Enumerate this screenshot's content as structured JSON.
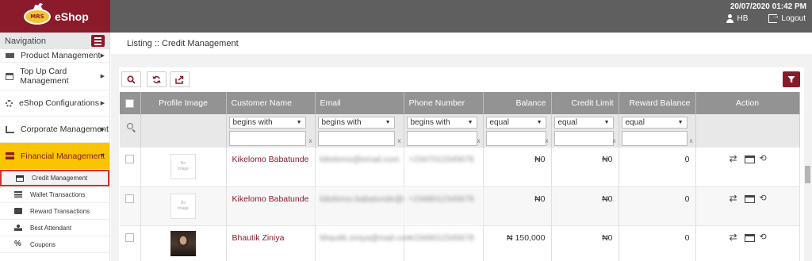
{
  "header": {
    "brand": "eShop",
    "logo_text": "MRS",
    "datetime": "20/07/2020 01:42 PM",
    "user": "HB",
    "logout": "Logout"
  },
  "sidebar": {
    "title": "Navigation",
    "items": [
      {
        "label": "Product Management",
        "icon": "box-icon"
      },
      {
        "label": "Top Up Card Management",
        "icon": "card-icon"
      },
      {
        "label": "eShop Configurations",
        "icon": "gear-icon"
      },
      {
        "label": "Corporate Management",
        "icon": "chart-icon"
      },
      {
        "label": "Financial Management",
        "icon": "finance-icon"
      }
    ],
    "sub_items": [
      {
        "label": "Credit Management",
        "icon": "card-icon"
      },
      {
        "label": "Wallet Transactions",
        "icon": "list-icon"
      },
      {
        "label": "Reward Transactions",
        "icon": "reward-icon"
      },
      {
        "label": "Best Attendant",
        "icon": "person-icon"
      },
      {
        "label": "Coupons",
        "icon": "percent-icon"
      }
    ]
  },
  "breadcrumb": "Listing :: Credit Management",
  "toolbar": {
    "filter_color": "#8b1a2b"
  },
  "table": {
    "columns": [
      "Profile Image",
      "Customer Name",
      "Email",
      "Phone Number",
      "Balance",
      "Credit Limit",
      "Reward Balance",
      "Action"
    ],
    "filters": {
      "name": "begins with",
      "email": "begins with",
      "phone": "begins with",
      "balance": "equal",
      "credit": "equal",
      "reward": "equal",
      "clear": "x"
    },
    "no_image": [
      "No",
      "Image"
    ],
    "rows": [
      {
        "name": "Kikelomo Babatunde",
        "email": "kikelomo@email.com",
        "phone": "+2347012345678",
        "balance": "₦0",
        "credit": "₦0",
        "reward": "0"
      },
      {
        "name": "Kikelomo Babatunde",
        "email": "kikelomo.babatunde@mail.com",
        "phone": "+2348012345678",
        "balance": "₦0",
        "credit": "₦0",
        "reward": "0"
      },
      {
        "name": "Bhautik Ziniya",
        "email": "bhautik.ziniya@mail.com",
        "phone": "+2349012345678",
        "balance": "₦ 150,000",
        "credit": "₦0",
        "reward": "0"
      }
    ]
  }
}
